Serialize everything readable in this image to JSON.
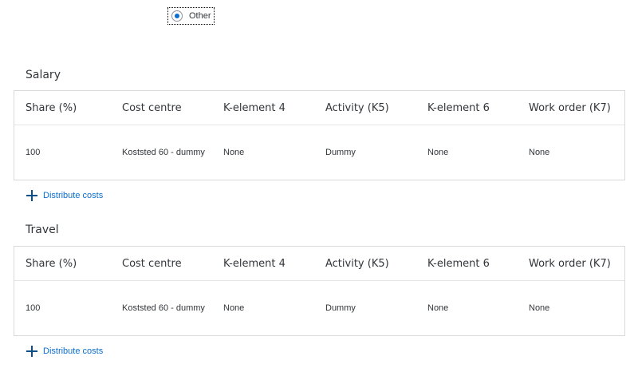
{
  "radio": {
    "label": "Other",
    "selected": true
  },
  "sections": [
    {
      "title": "Salary",
      "columns": [
        "Share (%)",
        "Cost centre",
        "K-element 4",
        "Activity (K5)",
        "K-element 6",
        "Work order (K7)"
      ],
      "rows": [
        [
          "100",
          "Koststed 60 - dummy",
          "None",
          "Dummy",
          "None",
          "None"
        ]
      ],
      "add_label": "Distribute costs"
    },
    {
      "title": "Travel",
      "columns": [
        "Share (%)",
        "Cost centre",
        "K-element 4",
        "Activity (K5)",
        "K-element 6",
        "Work order (K7)"
      ],
      "rows": [
        [
          "100",
          "Koststed 60 - dummy",
          "None",
          "Dummy",
          "None",
          "None"
        ]
      ],
      "add_label": "Distribute costs"
    }
  ],
  "colors": {
    "accent": "#0a6ed1",
    "plus_icon": "#0b4f8a",
    "border": "#d9d9d9",
    "text": "#32363a"
  }
}
